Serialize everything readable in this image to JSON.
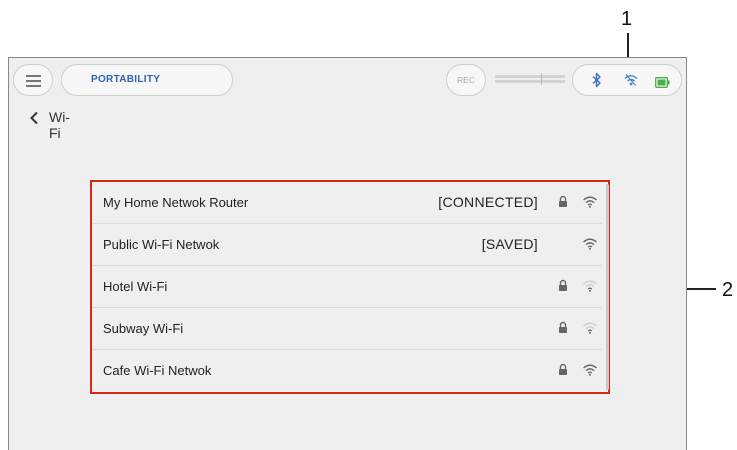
{
  "callouts": {
    "one": "1",
    "two": "2"
  },
  "header": {
    "tab_label": "PORTABILITY",
    "rec_label": "REC",
    "status_icons": [
      "bluetooth-icon",
      "wifi-connecting-icon",
      "battery-icon"
    ]
  },
  "nav": {
    "title": "Wi-Fi",
    "back_icon": "chevron-left-icon"
  },
  "wifi_list": {
    "networks": [
      {
        "name": "My Home Netwok Router",
        "status": "[CONNECTED]",
        "locked": true,
        "signal": "strong"
      },
      {
        "name": "Public Wi-Fi Netwok",
        "status": "[SAVED]",
        "locked": false,
        "signal": "strong"
      },
      {
        "name": "Hotel Wi-Fi",
        "status": "",
        "locked": true,
        "signal": "weak"
      },
      {
        "name": "Subway Wi-Fi",
        "status": "",
        "locked": true,
        "signal": "weak"
      },
      {
        "name": "Cafe Wi-Fi Netwok",
        "status": "",
        "locked": true,
        "signal": "strong"
      }
    ]
  },
  "colors": {
    "highlight": "#d9251d",
    "accent": "#2d63b0",
    "bluetooth": "#3a6fbf",
    "wifi_status": "#4a86c8",
    "battery": "#4cae4c"
  }
}
